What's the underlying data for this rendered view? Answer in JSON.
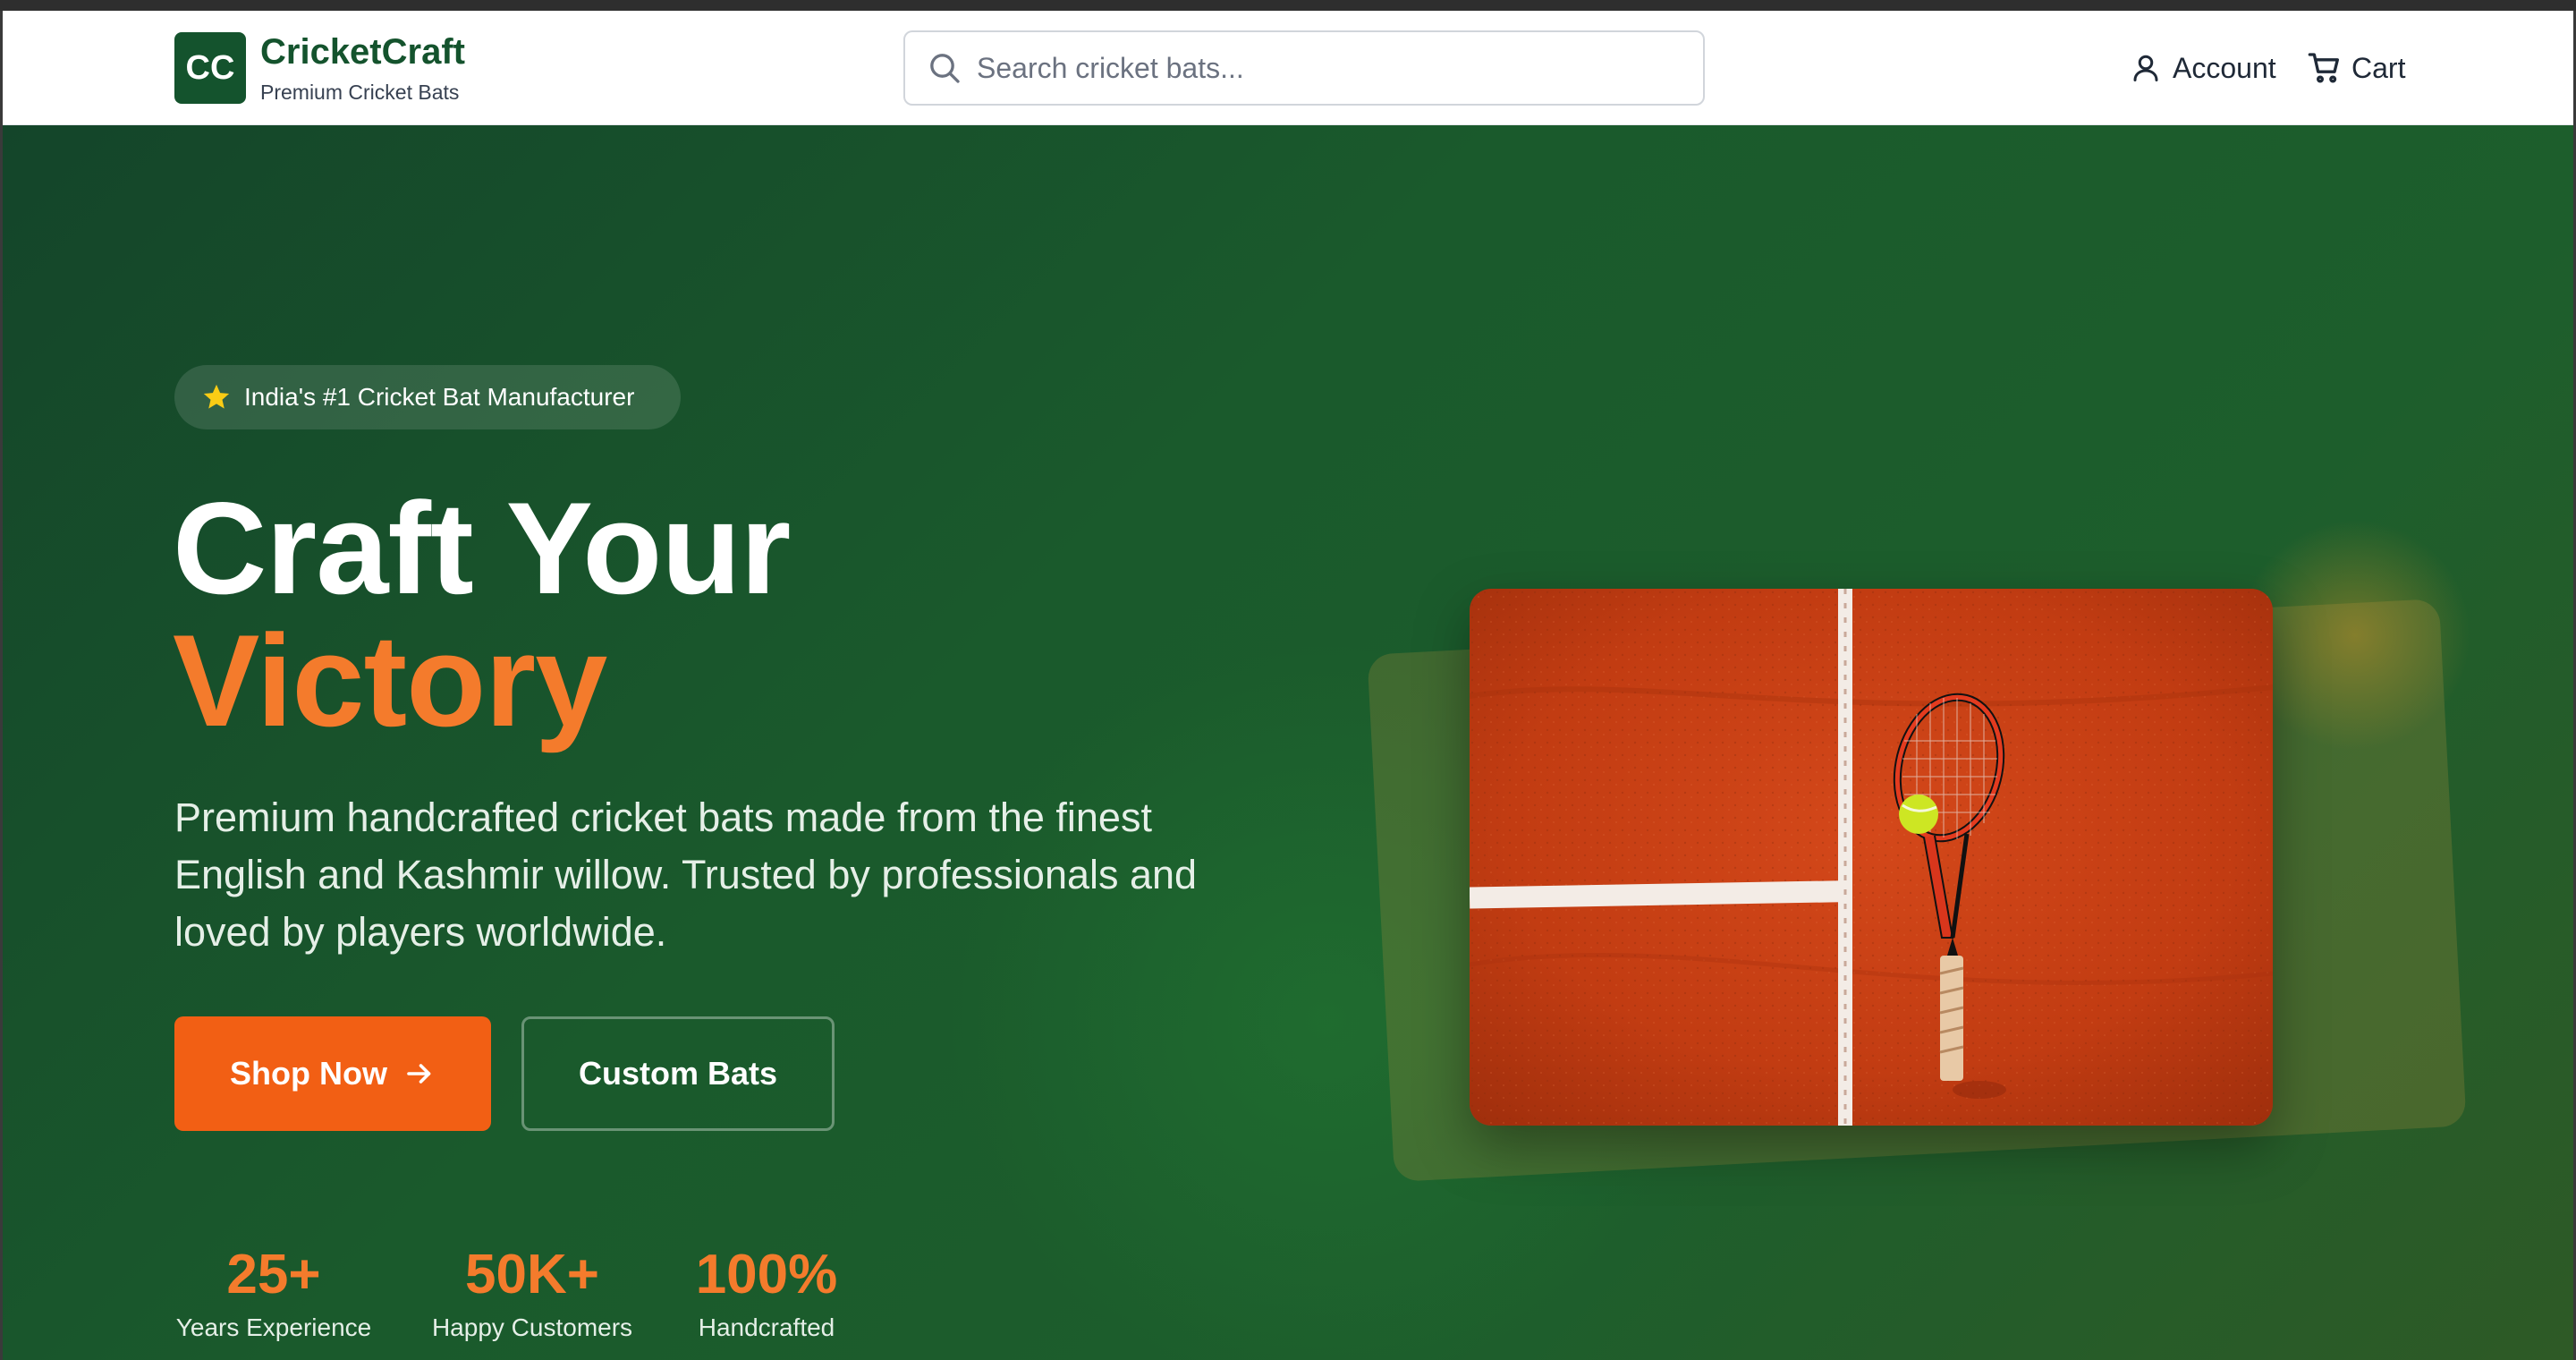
{
  "brand": {
    "logo_initials": "CC",
    "name": "CricketCraft",
    "tagline": "Premium Cricket Bats"
  },
  "search": {
    "placeholder": "Search cricket bats...",
    "value": ""
  },
  "nav": {
    "account_label": "Account",
    "cart_label": "Cart"
  },
  "hero": {
    "badge_text": "India's #1 Cricket Bat Manufacturer",
    "headline_line1": "Craft Your",
    "headline_line2": "Victory",
    "description": "Premium handcrafted cricket bats made from the finest English and Kashmir willow. Trusted by professionals and loved by players worldwide.",
    "primary_button": "Shop Now",
    "secondary_button": "Custom Bats",
    "stats": [
      {
        "value": "25+",
        "label": "Years Experience"
      },
      {
        "value": "50K+",
        "label": "Happy Customers"
      },
      {
        "value": "100%",
        "label": "Handcrafted"
      }
    ]
  },
  "icons": {
    "search": "search-icon",
    "account": "user-icon",
    "cart": "cart-icon",
    "badge": "star-icon",
    "button": "arrow-right-icon"
  },
  "colors": {
    "brand_green": "#14532d",
    "accent_orange": "#f47b2c",
    "button_orange": "#f25f14",
    "hero_bg": "#1a5a2c",
    "star_yellow": "#facc15",
    "court_clay": "#c2410c"
  }
}
